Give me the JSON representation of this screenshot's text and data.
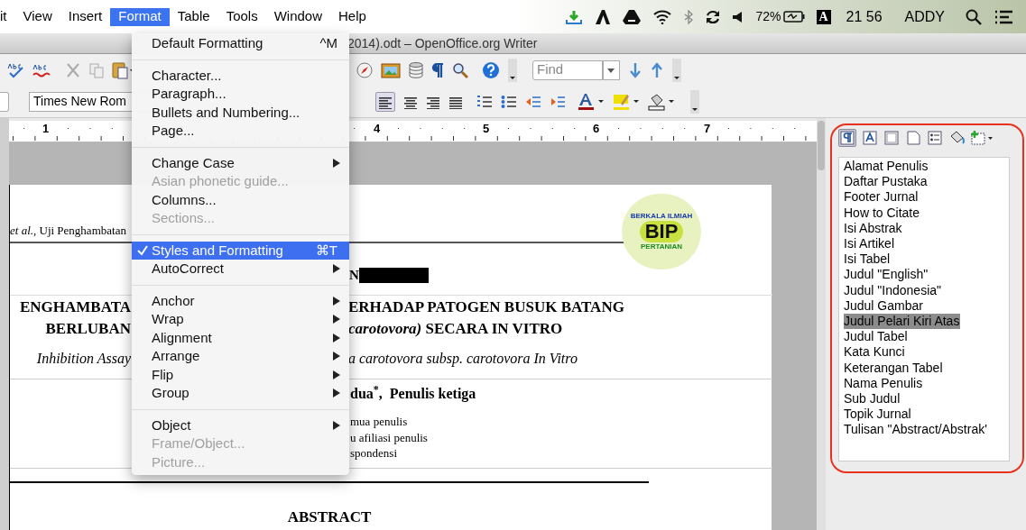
{
  "menu_bar": {
    "items": [
      {
        "label": "it",
        "selected": false
      },
      {
        "label": "View",
        "selected": false
      },
      {
        "label": "Insert",
        "selected": false
      },
      {
        "label": "Format",
        "selected": true
      },
      {
        "label": "Table",
        "selected": false
      },
      {
        "label": "Tools",
        "selected": false
      },
      {
        "label": "Window",
        "selected": false
      },
      {
        "label": "Help",
        "selected": false
      }
    ],
    "battery": "72%",
    "input_source": "A",
    "clock": "21 56",
    "user": "ADDY"
  },
  "window": {
    "title": "2014).odt – OpenOffice.org Writer"
  },
  "toolbar": {
    "find": {
      "placeholder": "Find"
    },
    "font_name": {
      "value": "Times New Rom"
    }
  },
  "ruler": {
    "labels": [
      "1",
      "4",
      "5",
      "6",
      "7"
    ]
  },
  "document": {
    "running_header": "*et al.*, Uji Penghambatan",
    "logo": {
      "top_text": "BERKALA ILMIAH",
      "center_text": "BIP",
      "bottom_text": "PERTANIAN"
    },
    "heading_fragment": "N",
    "title_lines": [
      {
        "left": "ENGHAMBATA",
        "right": "ERHADAP PATOGEN BUSUK BATANG"
      },
      {
        "left": "BERLUBAN",
        "right": "*carotovora)* SECARA IN VITRO"
      }
    ],
    "english_title": {
      "left": "Inhibition Assay",
      "right": "a carotovora subsp. carotovora In Vitro"
    },
    "authors": "dua$^{*}$,  Penulis ketiga",
    "affiliations": [
      "mua penulis",
      "u afiliasi penulis",
      "spondensi"
    ],
    "abstract_heading": "ABSTRACT"
  },
  "format_menu": {
    "items": [
      {
        "kind": "item",
        "label": "Default Formatting",
        "shortcut": "^M",
        "disabled": false,
        "checked": false,
        "submenu": false,
        "selected": false
      },
      {
        "kind": "separator"
      },
      {
        "kind": "item",
        "label": "Character...",
        "disabled": false,
        "checked": false,
        "submenu": false,
        "selected": false
      },
      {
        "kind": "item",
        "label": "Paragraph...",
        "disabled": false,
        "checked": false,
        "submenu": false,
        "selected": false
      },
      {
        "kind": "item",
        "label": "Bullets and Numbering...",
        "disabled": false,
        "checked": false,
        "submenu": false,
        "selected": false
      },
      {
        "kind": "item",
        "label": "Page...",
        "disabled": false,
        "checked": false,
        "submenu": false,
        "selected": false
      },
      {
        "kind": "separator"
      },
      {
        "kind": "item",
        "label": "Change Case",
        "disabled": false,
        "checked": false,
        "submenu": true,
        "selected": false
      },
      {
        "kind": "item",
        "label": "Asian phonetic guide...",
        "disabled": true,
        "checked": false,
        "submenu": false,
        "selected": false
      },
      {
        "kind": "item",
        "label": "Columns...",
        "disabled": false,
        "checked": false,
        "submenu": false,
        "selected": false
      },
      {
        "kind": "item",
        "label": "Sections...",
        "disabled": true,
        "checked": false,
        "submenu": false,
        "selected": false
      },
      {
        "kind": "separator"
      },
      {
        "kind": "item",
        "label": "Styles and Formatting",
        "shortcut": "⌘T",
        "disabled": false,
        "checked": true,
        "submenu": false,
        "selected": true
      },
      {
        "kind": "item",
        "label": "AutoCorrect",
        "disabled": false,
        "checked": false,
        "submenu": true,
        "selected": false
      },
      {
        "kind": "separator"
      },
      {
        "kind": "item",
        "label": "Anchor",
        "disabled": false,
        "checked": false,
        "submenu": true,
        "selected": false
      },
      {
        "kind": "item",
        "label": "Wrap",
        "disabled": false,
        "checked": false,
        "submenu": true,
        "selected": false
      },
      {
        "kind": "item",
        "label": "Alignment",
        "disabled": false,
        "checked": false,
        "submenu": true,
        "selected": false
      },
      {
        "kind": "item",
        "label": "Arrange",
        "disabled": false,
        "checked": false,
        "submenu": true,
        "selected": false
      },
      {
        "kind": "item",
        "label": "Flip",
        "disabled": false,
        "checked": false,
        "submenu": true,
        "selected": false
      },
      {
        "kind": "item",
        "label": "Group",
        "disabled": false,
        "checked": false,
        "submenu": true,
        "selected": false
      },
      {
        "kind": "separator"
      },
      {
        "kind": "item",
        "label": "Object",
        "disabled": false,
        "checked": false,
        "submenu": true,
        "selected": false
      },
      {
        "kind": "item",
        "label": "Frame/Object...",
        "disabled": true,
        "checked": false,
        "submenu": false,
        "selected": false
      },
      {
        "kind": "item",
        "label": "Picture...",
        "disabled": true,
        "checked": false,
        "submenu": false,
        "selected": false
      }
    ]
  },
  "styles_panel": {
    "items": [
      {
        "label": "Alamat Penulis",
        "selected": false
      },
      {
        "label": "Daftar Pustaka",
        "selected": false
      },
      {
        "label": "Footer Jurnal",
        "selected": false
      },
      {
        "label": "How to Citate",
        "selected": false
      },
      {
        "label": "Isi Abstrak",
        "selected": false
      },
      {
        "label": "Isi Artikel",
        "selected": false
      },
      {
        "label": "Isi Tabel",
        "selected": false
      },
      {
        "label": "Judul \"English\"",
        "selected": false
      },
      {
        "label": "Judul \"Indonesia\"",
        "selected": false
      },
      {
        "label": "Judul Gambar",
        "selected": false
      },
      {
        "label": "Judul Pelari Kiri Atas",
        "selected": true
      },
      {
        "label": "Judul Tabel",
        "selected": false
      },
      {
        "label": "Kata Kunci",
        "selected": false
      },
      {
        "label": "Keterangan Tabel",
        "selected": false
      },
      {
        "label": "Nama Penulis",
        "selected": false
      },
      {
        "label": "Sub Judul",
        "selected": false
      },
      {
        "label": "Topik Jurnal",
        "selected": false
      },
      {
        "label": "Tulisan \"Abstract/Abstrak'",
        "selected": false
      }
    ]
  }
}
